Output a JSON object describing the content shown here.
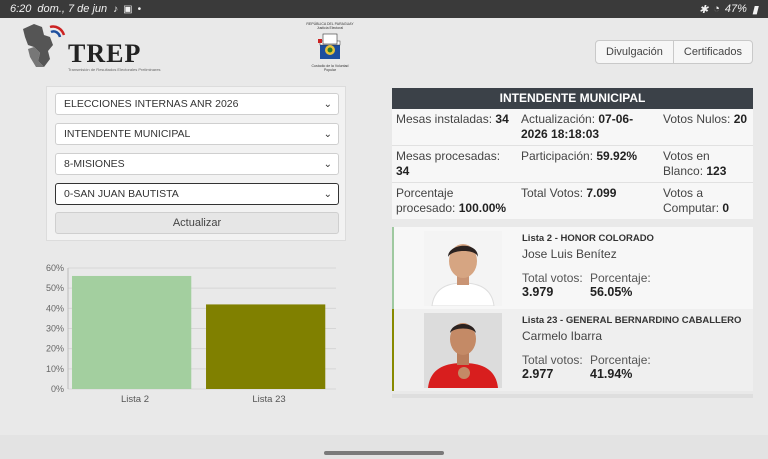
{
  "statusbar": {
    "time": "6:20",
    "date": "dom., 7 de jun",
    "battery": "47%"
  },
  "header": {
    "logo_text": "TREP",
    "logo_sub": "Transmisión de Resultados Electorales Preliminares",
    "crest_top": "REPÚBLICA DEL PARAGUAY",
    "crest_top2": "Justicia Electoral",
    "crest_bottom": "Custodio de la Voluntad Popular",
    "buttons": [
      "Divulgación",
      "Certificados"
    ]
  },
  "filters": {
    "election": "ELECCIONES INTERNAS ANR 2026",
    "position": "INTENDENTE MUNICIPAL",
    "department": "8-MISIONES",
    "district": "0-SAN JUAN BAUTISTA",
    "update_label": "Actualizar"
  },
  "results": {
    "title": "INTENDENTE MUNICIPAL",
    "stats": {
      "mesas_instaladas_label": "Mesas instaladas: ",
      "mesas_instaladas": "34",
      "actualizacion_label": "Actualización: ",
      "actualizacion": "07-06-2026 18:18:03",
      "votos_nulos_label": "Votos Nulos: ",
      "votos_nulos": "20",
      "mesas_procesadas_label": "Mesas procesadas: ",
      "mesas_procesadas": "34",
      "participacion_label": "Participación: ",
      "participacion": "59.92%",
      "votos_blanco_label": "Votos en Blanco: ",
      "votos_blanco": "123",
      "porcentaje_label": "Porcentaje procesado: ",
      "porcentaje": "100.00%",
      "total_votos_label": "Total Votos: ",
      "total_votos": "7.099",
      "votos_computar_label": "Votos a Computar: ",
      "votos_computar": "0"
    },
    "candidates": [
      {
        "lista": "Lista 2 - HONOR COLORADO",
        "name": "Jose Luis Benítez",
        "total_label": "Total votos:",
        "total": "3.979",
        "pct_label": "Porcentaje:",
        "pct": "56.05%"
      },
      {
        "lista": "Lista 23 - GENERAL BERNARDINO CABALLERO",
        "name": "Carmelo Ibarra",
        "total_label": "Total votos:",
        "total": "2.977",
        "pct_label": "Porcentaje:",
        "pct": "41.94%"
      }
    ]
  },
  "chart_data": {
    "type": "bar",
    "categories": [
      "Lista 2",
      "Lista 23"
    ],
    "values": [
      56.05,
      41.94
    ],
    "colors": [
      "#a3cf9f",
      "#808000"
    ],
    "ylim": [
      0,
      60
    ],
    "yticks": [
      0,
      10,
      20,
      30,
      40,
      50,
      60
    ],
    "ytick_labels": [
      "0%",
      "10%",
      "20%",
      "30%",
      "40%",
      "50%",
      "60%"
    ],
    "grid": true
  }
}
